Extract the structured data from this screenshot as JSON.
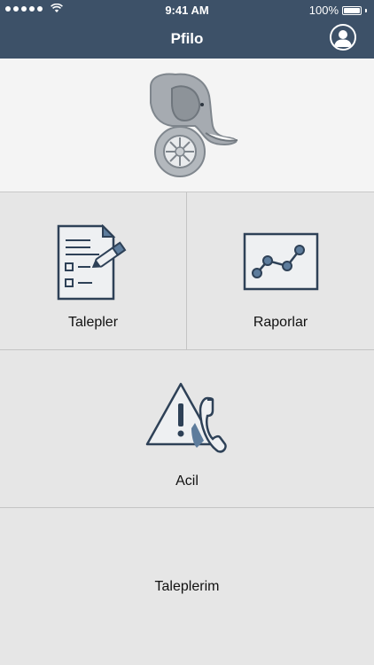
{
  "status": {
    "time": "9:41 AM",
    "battery": "100%",
    "signal_bars": 5
  },
  "nav": {
    "title": "Pfilo",
    "profile_icon": "user-circle-icon"
  },
  "hero": {
    "logo_icon": "elephant-wheel-logo"
  },
  "tiles": {
    "requests": {
      "label": "Talepler",
      "icon": "document-pen-icon"
    },
    "reports": {
      "label": "Raporlar",
      "icon": "line-chart-icon"
    },
    "emergency": {
      "label": "Acil",
      "icon": "warning-phone-icon"
    },
    "my_requests": {
      "label": "Taleplerim"
    }
  },
  "colors": {
    "nav": "#3d5168",
    "tile": "#e6e6e6",
    "hero": "#f4f4f4",
    "accent": "#5d7c9c",
    "icon_stroke": "#2e4157"
  }
}
